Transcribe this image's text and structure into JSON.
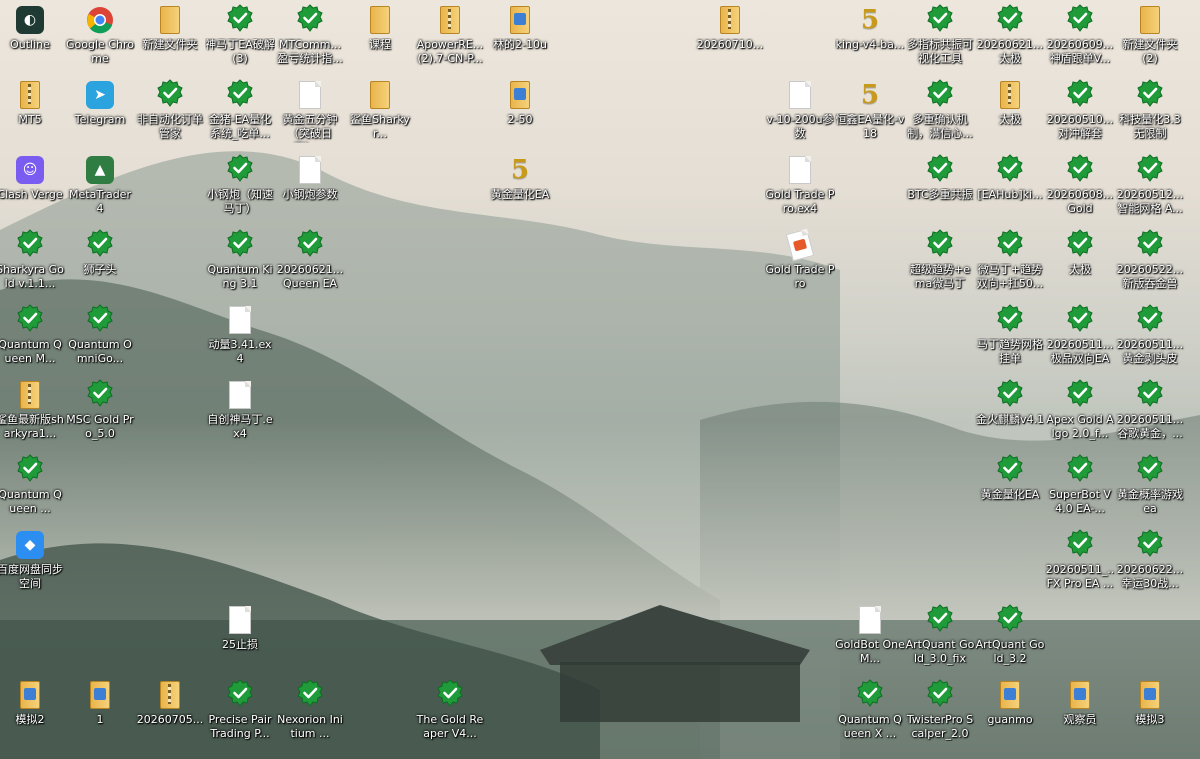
{
  "desktop": {
    "icons": [
      {
        "label": "Outline",
        "kind": "app",
        "color": "#1f3a33",
        "glyph": "◐"
      },
      {
        "label": "Google Chrome",
        "kind": "chrome"
      },
      {
        "label": "新建文件夹",
        "kind": "folder"
      },
      {
        "label": "神马丁EA破解(3)",
        "kind": "shield"
      },
      {
        "label": "MTComm...盈亏统计指...",
        "kind": "shield"
      },
      {
        "label": "课程",
        "kind": "folder"
      },
      {
        "label": "ApowerRE...(2).7-CN-P...",
        "kind": "zip"
      },
      {
        "label": "林的2-10u",
        "kind": "blue-folder"
      },
      {
        "label": "20260710...",
        "kind": "zip"
      },
      {
        "label": "king-v4-ba...",
        "kind": "five"
      },
      {
        "label": "多指标共振可视化工具",
        "kind": "shield"
      },
      {
        "label": "20260621...太极",
        "kind": "shield"
      },
      {
        "label": "20260609...神盾跟单V...",
        "kind": "shield"
      },
      {
        "label": "新建文件夹(2)",
        "kind": "folder"
      },
      {
        "label": "MT5",
        "kind": "zip"
      },
      {
        "label": "Telegram",
        "kind": "app",
        "color": "#2aa3df",
        "glyph": "➤"
      },
      {
        "label": "非自动化订单管家",
        "kind": "shield"
      },
      {
        "label": "金猪-EA量化系统_吃单...",
        "kind": "shield"
      },
      {
        "label": "黄金五分钟（突破日天）...",
        "kind": "doc"
      },
      {
        "label": "鲨鱼Sharkyr...",
        "kind": "folder"
      },
      {
        "label": "2-50",
        "kind": "blue-folder"
      },
      {
        "label": "v-10-200u参数",
        "kind": "doc"
      },
      {
        "label": "恒鑫EA量化-v18",
        "kind": "five"
      },
      {
        "label": "多重确认机制，满信心...",
        "kind": "shield"
      },
      {
        "label": "太极",
        "kind": "zip"
      },
      {
        "label": "20260510...对冲解套",
        "kind": "shield"
      },
      {
        "label": "科技量化3.3无限制",
        "kind": "shield"
      },
      {
        "label": "Clash Verge",
        "kind": "app",
        "color": "#7b5cf0",
        "glyph": "☺"
      },
      {
        "label": "MetaTrader 4",
        "kind": "app",
        "color": "#2f7d43",
        "glyph": "▲"
      },
      {
        "label": "小钢炮（知速马丁）",
        "kind": "shield"
      },
      {
        "label": "小钢炮参数",
        "kind": "doc"
      },
      {
        "label": "黄金量化EA",
        "kind": "five"
      },
      {
        "label": "Gold Trade Pro.ex4",
        "kind": "doc"
      },
      {
        "label": "BTC多重共振",
        "kind": "shield"
      },
      {
        "label": "[EAHub]ki...",
        "kind": "shield"
      },
      {
        "label": "20260608...Gold",
        "kind": "shield"
      },
      {
        "label": "20260512...智能网格 A...",
        "kind": "shield"
      },
      {
        "label": "Sharkyra Gold v.1.1...",
        "kind": "shield"
      },
      {
        "label": "狮子头",
        "kind": "shield"
      },
      {
        "label": "Quantum King 3.1",
        "kind": "shield"
      },
      {
        "label": "20260621...Queen EA",
        "kind": "shield"
      },
      {
        "label": "Gold Trade Pro",
        "kind": "gtp"
      },
      {
        "label": "超级趋势+ema微马丁",
        "kind": "shield"
      },
      {
        "label": "微马丁+趋势双向+扛50...",
        "kind": "shield"
      },
      {
        "label": "太极",
        "kind": "shield"
      },
      {
        "label": "20260522...新版吞金兽",
        "kind": "shield"
      },
      {
        "label": "Quantum Queen M...",
        "kind": "shield"
      },
      {
        "label": "Quantum OmniGo...",
        "kind": "shield"
      },
      {
        "label": "动量3.41.ex4",
        "kind": "doc"
      },
      {
        "label": "马丁趋势网格挂单",
        "kind": "shield"
      },
      {
        "label": "20260511...极品双向EA",
        "kind": "shield"
      },
      {
        "label": "20260511...黄金剥头皮",
        "kind": "shield"
      },
      {
        "label": "鲨鱼最新版sharkyra1...",
        "kind": "zip"
      },
      {
        "label": "MSC Gold Pro_5.0",
        "kind": "shield"
      },
      {
        "label": "自创神马丁.ex4",
        "kind": "doc"
      },
      {
        "label": "金火麒麟v4.1",
        "kind": "shield"
      },
      {
        "label": "Apex Gold Algo 2.0_f...",
        "kind": "shield"
      },
      {
        "label": "20260511...谷歌黄金，...",
        "kind": "shield"
      },
      {
        "label": "Quantum Queen ...",
        "kind": "shield"
      },
      {
        "label": "黄金量化EA",
        "kind": "shield"
      },
      {
        "label": "SuperBot V4.0 EA-...",
        "kind": "shield"
      },
      {
        "label": "黄金概率游戏ea",
        "kind": "shield"
      },
      {
        "label": "百度网盘同步空间",
        "kind": "app",
        "color": "#2b8ef0",
        "glyph": "◆"
      },
      {
        "label": "20260511_..FX Pro EA ...",
        "kind": "shield"
      },
      {
        "label": "20260622...幸运30战...",
        "kind": "shield"
      },
      {
        "label": "25止损",
        "kind": "doc"
      },
      {
        "label": "GoldBot One M...",
        "kind": "doc"
      },
      {
        "label": "ArtQuant Gold_3.0_fix",
        "kind": "shield"
      },
      {
        "label": "ArtQuant Gold_3.2",
        "kind": "shield"
      },
      {
        "label": "模拟2",
        "kind": "blue-folder"
      },
      {
        "label": "1",
        "kind": "blue-folder"
      },
      {
        "label": "20260705...",
        "kind": "zip"
      },
      {
        "label": "Precise Pair Trading P...",
        "kind": "shield"
      },
      {
        "label": "Nexorion Initium ...",
        "kind": "shield"
      },
      {
        "label": "The Gold Reaper V4...",
        "kind": "shield"
      },
      {
        "label": "Quantum Queen X ...",
        "kind": "shield"
      },
      {
        "label": "TwisterPro Scalper_2.0",
        "kind": "shield"
      },
      {
        "label": "guanmo",
        "kind": "blue-folder"
      },
      {
        "label": "观察员",
        "kind": "blue-folder"
      },
      {
        "label": "模拟3",
        "kind": "blue-folder"
      }
    ]
  },
  "colors": {
    "shield": "#1f9b3a",
    "shieldEdge": "#0d6e22",
    "folder": "#e9b44c",
    "blueFolder": "#3e7fd6"
  }
}
